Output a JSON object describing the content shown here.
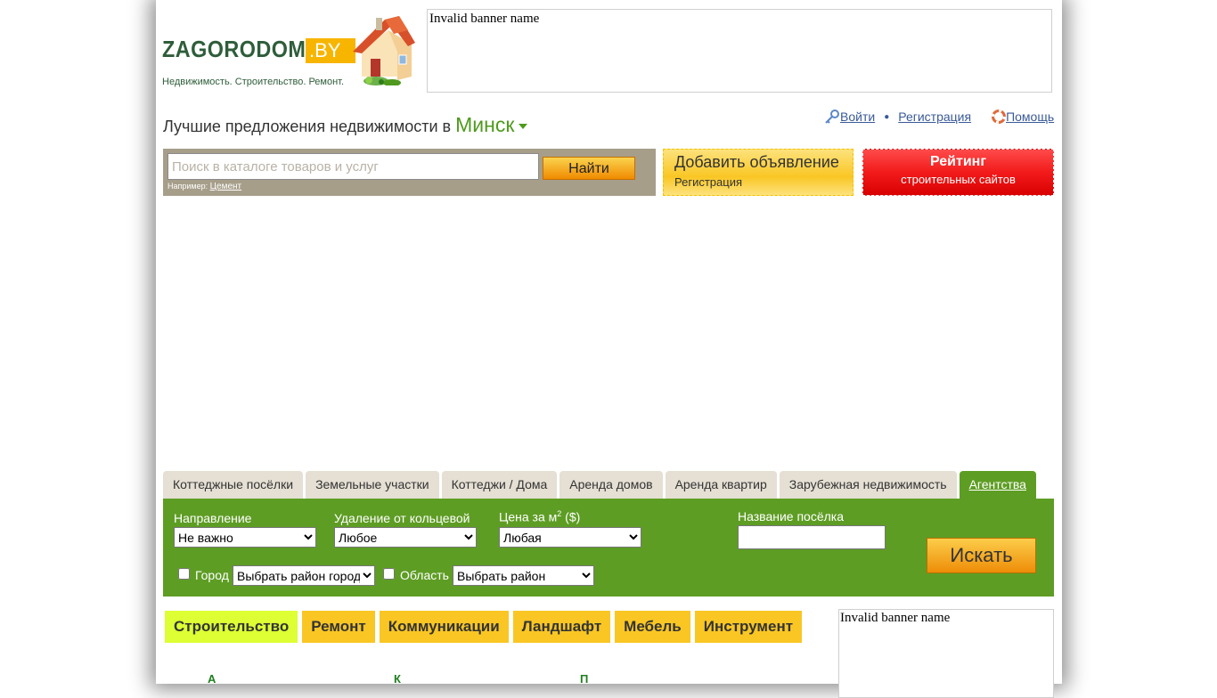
{
  "logo": {
    "word": "ZAGORODOM",
    "tld": ".BY",
    "tagline": "Недвижимость. Строительство. Ремонт."
  },
  "banner_top": {
    "text": "Invalid banner name"
  },
  "region": {
    "prefix": "Лучшие предложения недвижимости в",
    "city": "Минск"
  },
  "userbar": {
    "login": "Войти",
    "register": "Регистрация",
    "help": "Помощь"
  },
  "search": {
    "placeholder": "Поиск в каталоге товаров и услуг",
    "button": "Найти",
    "example_label": "Например:",
    "example_link": "Цемент"
  },
  "add_ad": {
    "title": "Добавить объявление",
    "subtitle": "Регистрация"
  },
  "rating": {
    "title": "Рейтинг",
    "subtitle": "строительных сайтов"
  },
  "tabs": [
    {
      "label": "Коттеджные посёлки"
    },
    {
      "label": "Земельные участки"
    },
    {
      "label": "Коттеджи / Дома"
    },
    {
      "label": "Аренда домов"
    },
    {
      "label": "Аренда квартир"
    },
    {
      "label": "Зарубежная недвижимость"
    },
    {
      "label": "Агентства",
      "active": true
    }
  ],
  "filter": {
    "direction_label": "Направление",
    "direction_value": "Не важно",
    "distance_label": "Удаление от кольцевой",
    "distance_value": "Любое",
    "price_label_pre": "Цена за м",
    "price_label_sup": "2",
    "price_label_post": " ($)",
    "price_value": "Любая",
    "settlement_label": "Название посёлка",
    "settlement_value": "",
    "city_label": "Город",
    "city_select": "Выбрать район города",
    "region_label": "Область",
    "region_select": "Выбрать район",
    "search_button": "Искать"
  },
  "categories": [
    {
      "label": "Строительство",
      "active": true
    },
    {
      "label": "Ремонт"
    },
    {
      "label": "Коммуникации"
    },
    {
      "label": "Ландшафт"
    },
    {
      "label": "Мебель"
    },
    {
      "label": "Инструмент"
    }
  ],
  "banner_side": {
    "text": "Invalid banner name"
  },
  "letters": [
    "А",
    "К",
    "П"
  ],
  "colors": {
    "green": "#5e9d24",
    "yellow": "#f9c624",
    "red": "#f21a1a",
    "link": "#3a5a98"
  }
}
